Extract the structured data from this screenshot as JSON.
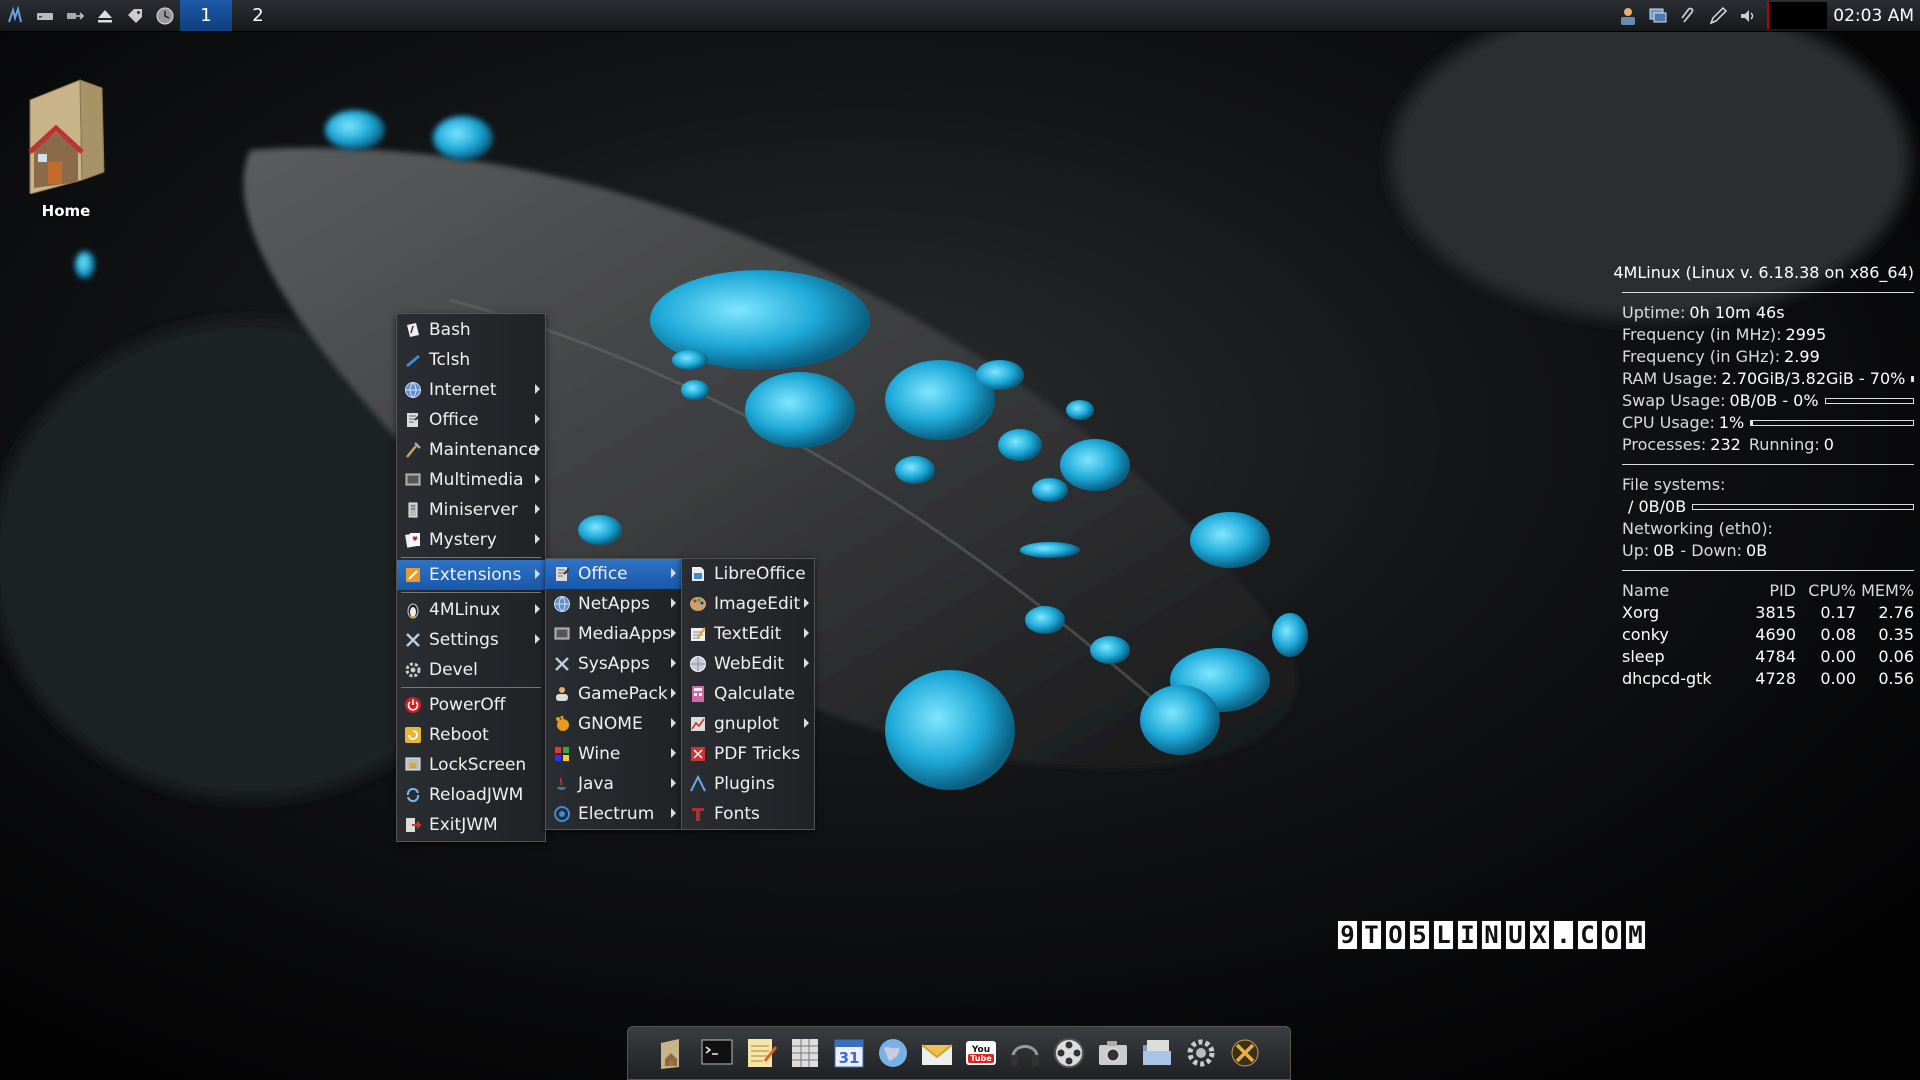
{
  "top_panel": {
    "tray_left": [
      "jwm-logo-icon",
      "drive-icon",
      "network-icon",
      "eject-icon",
      "tag-icon",
      "clock-app-icon"
    ],
    "desktops": [
      {
        "label": "1",
        "active": true
      },
      {
        "label": "2",
        "active": false
      }
    ],
    "tray_right": [
      "user-icon",
      "display-icon",
      "clip-icon",
      "pen-icon",
      "speaker-icon"
    ],
    "clock": "02:03 AM"
  },
  "desktop": {
    "home_label": "Home"
  },
  "conky": {
    "title": "4MLinux (Linux v. 6.18.38 on x86_64)",
    "uptime_k": "Uptime:",
    "uptime_v": "0h 10m 46s",
    "freq_mhz_k": "Frequency (in MHz):",
    "freq_mhz_v": "2995",
    "freq_ghz_k": "Frequency (in GHz):",
    "freq_ghz_v": "2.99",
    "ram_k": "RAM Usage:",
    "ram_v": "2.70GiB/3.82GiB - 70%",
    "ram_pct": 70,
    "swap_k": "Swap Usage:",
    "swap_v": "0B/0B - 0%",
    "swap_pct": 0,
    "cpu_k": "CPU Usage:",
    "cpu_v": "1%",
    "cpu_pct": 1,
    "proc_k": "Processes:",
    "proc_v": "232",
    "running_k": "Running:",
    "running_v": "0",
    "fs_k": "File systems:",
    "fs_root": "/  0B/0B",
    "fs_pct": 0,
    "net_k": "Networking (eth0):",
    "up_k": "Up:",
    "up_v": "0B",
    "down_k": "- Down:",
    "down_v": "0B",
    "proc_header": [
      "Name",
      "PID",
      "CPU%",
      "MEM%"
    ],
    "processes": [
      [
        "Xorg",
        "3815",
        "0.17",
        "2.76"
      ],
      [
        "conky",
        "4690",
        "0.08",
        "0.35"
      ],
      [
        "sleep",
        "4784",
        "0.00",
        "0.06"
      ],
      [
        "dhcpcd-gtk",
        "4728",
        "0.00",
        "0.56"
      ]
    ]
  },
  "watermark": [
    "9",
    "T",
    "O",
    "5",
    "L",
    "I",
    "N",
    "U",
    "X",
    ".",
    "C",
    "O",
    "M"
  ],
  "main_menu": {
    "items": [
      {
        "label": "Bash",
        "icon": "bash-icon",
        "submenu": false
      },
      {
        "label": "Tclsh",
        "icon": "tclsh-icon",
        "submenu": false
      },
      {
        "label": "Internet",
        "icon": "globe-icon",
        "submenu": true
      },
      {
        "label": "Office",
        "icon": "office-icon",
        "submenu": true
      },
      {
        "label": "Maintenance",
        "icon": "wrench-icon",
        "submenu": true
      },
      {
        "label": "Multimedia",
        "icon": "multimedia-icon",
        "submenu": true
      },
      {
        "label": "Miniserver",
        "icon": "server-icon",
        "submenu": true
      },
      {
        "label": "Mystery",
        "icon": "cards-icon",
        "submenu": true
      },
      {
        "label": "Extensions",
        "icon": "extensions-icon",
        "submenu": true
      },
      {
        "label": "4MLinux",
        "icon": "penguin-icon",
        "submenu": true
      },
      {
        "label": "Settings",
        "icon": "tools-icon",
        "submenu": true
      },
      {
        "label": "Devel",
        "icon": "gear-icon",
        "submenu": false
      },
      {
        "label": "PowerOff",
        "icon": "power-icon",
        "submenu": false
      },
      {
        "label": "Reboot",
        "icon": "reboot-icon",
        "submenu": false
      },
      {
        "label": "LockScreen",
        "icon": "lock-icon",
        "submenu": false
      },
      {
        "label": "ReloadJWM",
        "icon": "reload-icon",
        "submenu": false
      },
      {
        "label": "ExitJWM",
        "icon": "exit-icon",
        "submenu": false
      }
    ]
  },
  "extensions_menu": {
    "items": [
      {
        "label": "Office",
        "icon": "office-icon"
      },
      {
        "label": "NetApps",
        "icon": "globe-icon"
      },
      {
        "label": "MediaApps",
        "icon": "multimedia-icon"
      },
      {
        "label": "SysApps",
        "icon": "tools-icon"
      },
      {
        "label": "GamePack",
        "icon": "gamepad-icon"
      },
      {
        "label": "GNOME",
        "icon": "gnome-icon"
      },
      {
        "label": "Wine",
        "icon": "wine-icon"
      },
      {
        "label": "Java",
        "icon": "java-icon"
      },
      {
        "label": "Electrum",
        "icon": "electrum-icon"
      }
    ]
  },
  "office_menu": {
    "items": [
      {
        "label": "LibreOffice",
        "icon": "libreoffice-icon",
        "submenu": false
      },
      {
        "label": "ImageEdit",
        "icon": "palette-icon",
        "submenu": true
      },
      {
        "label": "TextEdit",
        "icon": "textedit-icon",
        "submenu": true
      },
      {
        "label": "WebEdit",
        "icon": "webedit-icon",
        "submenu": true
      },
      {
        "label": "Qalculate",
        "icon": "calculator-icon",
        "submenu": false
      },
      {
        "label": "gnuplot",
        "icon": "gnuplot-icon",
        "submenu": true
      },
      {
        "label": "PDF Tricks",
        "icon": "pdf-icon",
        "submenu": false
      },
      {
        "label": "Plugins",
        "icon": "plugins-icon",
        "submenu": false
      },
      {
        "label": "Fonts",
        "icon": "fonts-icon",
        "submenu": false
      }
    ]
  },
  "dock": [
    "home-folder-icon",
    "terminal-icon",
    "notepad-icon",
    "spreadsheet-icon",
    "calendar-icon",
    "browser-icon",
    "mail-icon",
    "youtube-icon",
    "headphones-icon",
    "film-reel-icon",
    "camera-icon",
    "file-manager-icon",
    "settings-icon",
    "close-app-icon"
  ],
  "dock_texts": {
    "calendar_day": "31",
    "youtube_you": "You",
    "youtube_tube": "Tube"
  }
}
